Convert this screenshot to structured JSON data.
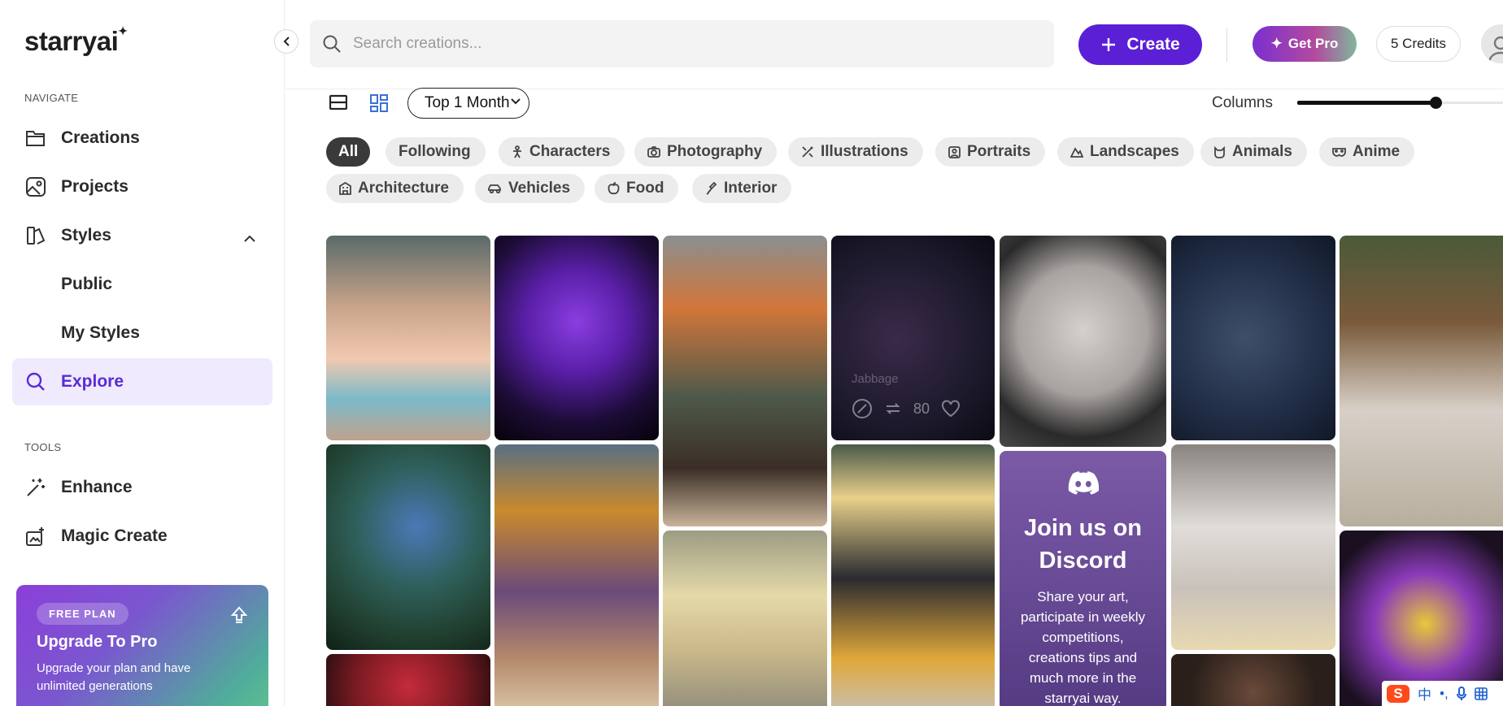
{
  "sidebar": {
    "logo": "starryai",
    "navigate_label": "NAVIGATE",
    "tools_label": "TOOLS",
    "items": [
      {
        "label": "Creations",
        "icon": "folder-icon"
      },
      {
        "label": "Projects",
        "icon": "image-icon"
      },
      {
        "label": "Styles",
        "icon": "palette-icon"
      },
      {
        "label": "Public"
      },
      {
        "label": "My Styles"
      },
      {
        "label": "Explore",
        "icon": "search-icon"
      }
    ],
    "tools": [
      {
        "label": "Enhance",
        "icon": "magic-wand-icon"
      },
      {
        "label": "Magic Create",
        "icon": "magic-create-icon"
      }
    ],
    "upgrade": {
      "badge": "FREE PLAN",
      "title": "Upgrade To Pro",
      "description": "Upgrade your plan and have unlimited generations"
    }
  },
  "header": {
    "search_placeholder": "Search creations...",
    "create_label": "Create",
    "get_pro_label": "Get Pro",
    "credits_label": "5 Credits"
  },
  "toolbar": {
    "period": "Top 1 Month",
    "columns_label": "Columns",
    "columns_level": 0.67
  },
  "filters": [
    {
      "label": "All",
      "active": true
    },
    {
      "label": "Following"
    },
    {
      "label": "Characters",
      "icon": "person-icon"
    },
    {
      "label": "Photography",
      "icon": "camera-icon"
    },
    {
      "label": "Illustrations",
      "icon": "brush-icon"
    },
    {
      "label": "Portraits",
      "icon": "portrait-icon"
    },
    {
      "label": "Landscapes",
      "icon": "mountain-icon"
    },
    {
      "label": "Animals",
      "icon": "cat-icon"
    },
    {
      "label": "Anime",
      "icon": "mask-icon"
    },
    {
      "label": "Architecture",
      "icon": "building-icon"
    },
    {
      "label": "Vehicles",
      "icon": "car-icon"
    },
    {
      "label": "Food",
      "icon": "apple-icon"
    },
    {
      "label": "Interior",
      "icon": "paint-roller-icon"
    }
  ],
  "gallery": {
    "hover_label": "Jabbage",
    "hover_count": "80"
  },
  "discord": {
    "title": "Join us on Discord",
    "description": "Share your art, participate in weekly competitions, creations tips and much more in the starryai way."
  },
  "ime": {
    "lang": "中"
  },
  "colors": {
    "brand_purple": "#5b1fd6",
    "active_nav_bg": "#efeafd",
    "active_nav_text": "#5b2bd6"
  }
}
